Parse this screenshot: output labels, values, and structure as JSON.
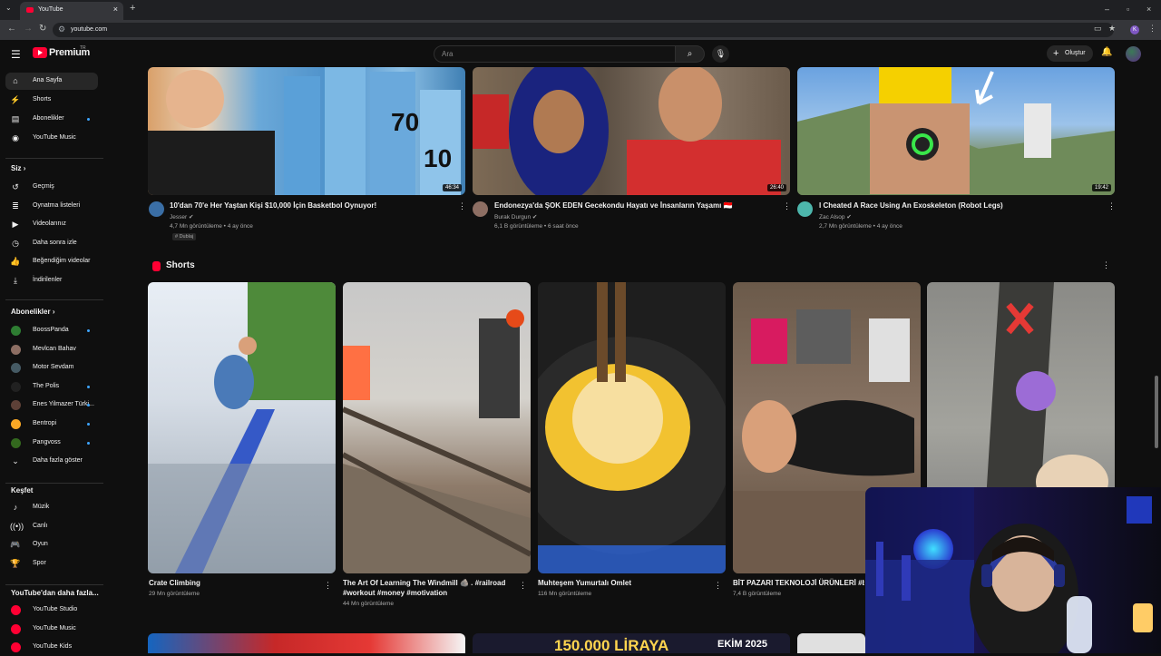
{
  "browser": {
    "tab_title": "YouTube",
    "url": "youtube.com",
    "profile_letter": "K",
    "new_tab_glyph": "+",
    "close_tab_glyph": "×"
  },
  "header": {
    "logo_text": "Premium",
    "logo_superscript": "TR",
    "search_placeholder": "Ara",
    "create_label": "Oluştur"
  },
  "sidebar": {
    "main": [
      {
        "label": "Ana Sayfa",
        "icon": "home-icon",
        "glyph": "⌂",
        "active": true
      },
      {
        "label": "Shorts",
        "icon": "shorts-icon",
        "glyph": "⚡"
      },
      {
        "label": "Abonelikler",
        "icon": "subscriptions-icon",
        "glyph": "▤",
        "dot": true
      },
      {
        "label": "YouTube Music",
        "icon": "music-icon",
        "glyph": "◉"
      }
    ],
    "you_heading": "Siz",
    "you": [
      {
        "label": "Geçmiş",
        "icon": "history-icon",
        "glyph": "↺"
      },
      {
        "label": "Oynatma listeleri",
        "icon": "playlist-icon",
        "glyph": "≣"
      },
      {
        "label": "Videolarınız",
        "icon": "your-videos-icon",
        "glyph": "▶"
      },
      {
        "label": "Daha sonra izle",
        "icon": "watch-later-icon",
        "glyph": "◷"
      },
      {
        "label": "Beğendiğim videolar",
        "icon": "like-icon",
        "glyph": "👍"
      },
      {
        "label": "İndirilenler",
        "icon": "download-icon",
        "glyph": "⤓"
      }
    ],
    "subs_heading": "Abonelikler",
    "subs": [
      {
        "label": "BoossPanda",
        "color": "#2e7d32",
        "dot": true
      },
      {
        "label": "Mevlcan Bahav",
        "color": "#8d6e63"
      },
      {
        "label": "Motor Sevdam",
        "color": "#455a64"
      },
      {
        "label": "The Polis",
        "color": "#212121",
        "dot": true
      },
      {
        "label": "Enes Yilmazer Türki...",
        "color": "#5d4037",
        "dot": true
      },
      {
        "label": "Bentropi",
        "color": "#f9a825",
        "dot": true
      },
      {
        "label": "Pangvoss",
        "color": "#33691e",
        "dot": true
      }
    ],
    "more_label": "Daha fazla göster",
    "explore_heading": "Keşfet",
    "explore": [
      {
        "label": "Müzik",
        "icon": "music-note-icon",
        "glyph": "♪"
      },
      {
        "label": "Canlı",
        "icon": "live-icon",
        "glyph": "((•))"
      },
      {
        "label": "Oyun",
        "icon": "gaming-icon",
        "glyph": "🎮"
      },
      {
        "label": "Spor",
        "icon": "trophy-icon",
        "glyph": "🏆"
      }
    ],
    "more_from_heading": "YouTube'dan daha fazla...",
    "more_from": [
      {
        "label": "YouTube Studio",
        "color": "#ff0033"
      },
      {
        "label": "YouTube Music",
        "color": "#ff0033"
      },
      {
        "label": "YouTube Kids",
        "color": "#ff0033"
      }
    ]
  },
  "videos": [
    {
      "title": "10'dan 70'e Her Yaştan Kişi $10,000 İçin Basketbol Oynuyor!",
      "channel": "Jesser",
      "meta": "4,7 Mn görüntüleme • 4 ay önce",
      "duration": "46:34",
      "badge": "# Dublaj"
    },
    {
      "title": "Endonezya'da ŞOK EDEN Gecekondu Hayatı ve İnsanların Yaşamı 🇮🇩",
      "channel": "Burak Durgun",
      "meta": "6,1 B görüntüleme • 6 saat önce",
      "duration": "26:40"
    },
    {
      "title": "I Cheated A Race Using An Exoskeleton (Robot Legs)",
      "channel": "Zac Alsop",
      "meta": "2,7 Mn görüntüleme • 4 ay önce",
      "duration": "19:42"
    }
  ],
  "shorts_heading": "Shorts",
  "shorts": [
    {
      "title": "Crate Climbing",
      "meta": "29 Mn görüntüleme"
    },
    {
      "title": "The Art Of Learning The Windmill 🪨 . #railroad #workout #money #motivation",
      "meta": "44 Mn görüntüleme"
    },
    {
      "title": "Muhteşem Yumurtalı Omlet",
      "meta": "116 Mn görüntüleme"
    },
    {
      "title": "BİT PAZARI TEKNOLOJİ ÜRÜNLERİ #bitp",
      "meta": "7,4 B görüntüleme"
    },
    {
      "title": "",
      "meta": ""
    }
  ],
  "bottom_row": {
    "thumb2_text": "150.000 LİRAYA",
    "thumb2_badge": "EKİM 2025"
  }
}
